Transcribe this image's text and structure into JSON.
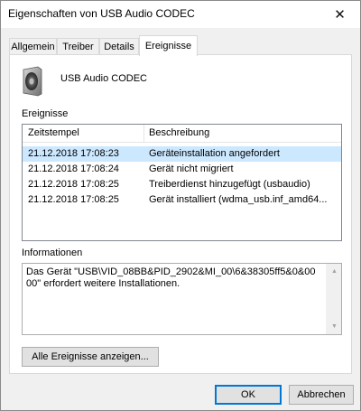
{
  "window": {
    "title": "Eigenschaften von USB Audio CODEC",
    "close_glyph": "✕"
  },
  "tabs": [
    {
      "label": "Allgemein",
      "active": false
    },
    {
      "label": "Treiber",
      "active": false
    },
    {
      "label": "Details",
      "active": false
    },
    {
      "label": "Ereignisse",
      "active": true
    }
  ],
  "device": {
    "icon": "speaker-icon",
    "name": "USB Audio CODEC"
  },
  "events": {
    "label": "Ereignisse",
    "columns": [
      "Zeitstempel",
      "Beschreibung"
    ],
    "rows": [
      {
        "timestamp": "21.12.2018 17:08:23",
        "description": "Geräteinstallation angefordert",
        "selected": true
      },
      {
        "timestamp": "21.12.2018 17:08:24",
        "description": "Gerät nicht migriert",
        "selected": false
      },
      {
        "timestamp": "21.12.2018 17:08:25",
        "description": "Treiberdienst hinzugefügt (usbaudio)",
        "selected": false
      },
      {
        "timestamp": "21.12.2018 17:08:25",
        "description": "Gerät installiert (wdma_usb.inf_amd64...",
        "selected": false
      }
    ]
  },
  "info": {
    "label": "Informationen",
    "text": "Das Gerät \"USB\\VID_08BB&PID_2902&MI_00\\6&38305ff5&0&0000\" erfordert weitere Installationen."
  },
  "buttons": {
    "all_events": "Alle Ereignisse anzeigen...",
    "ok": "OK",
    "cancel": "Abbrechen"
  },
  "colors": {
    "selection": "#cce8ff",
    "default_button_border": "#0078d7"
  }
}
